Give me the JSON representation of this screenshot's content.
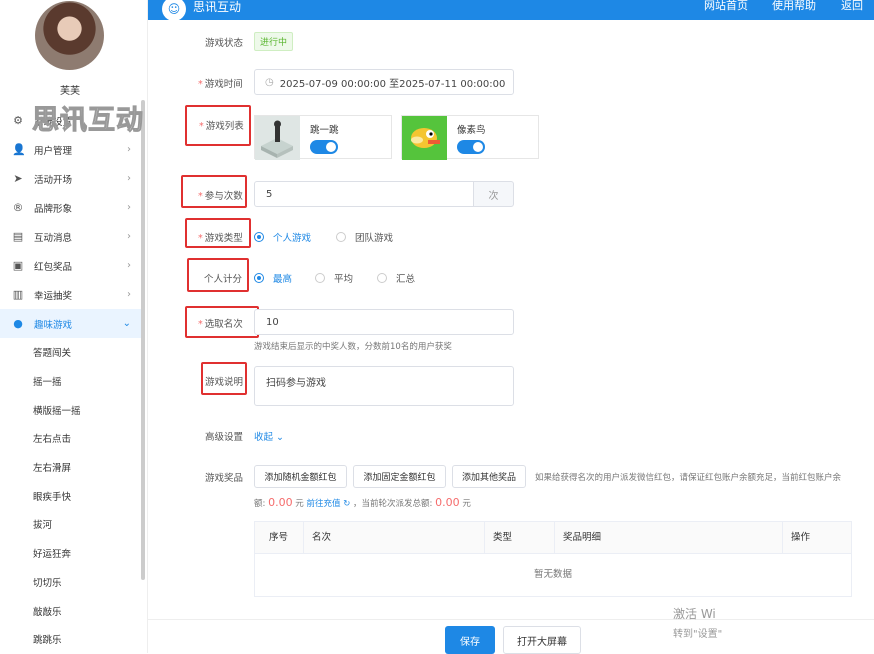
{
  "user": {
    "name": "芙芙"
  },
  "watermark": "思讯互动",
  "sidebar": {
    "items": [
      {
        "label": "系统设置",
        "icon": "gear-icon"
      },
      {
        "label": "用户管理",
        "icon": "user-icon"
      },
      {
        "label": "活动开场",
        "icon": "send-icon"
      },
      {
        "label": "品牌形象",
        "icon": "registered-icon"
      },
      {
        "label": "互动消息",
        "icon": "message-icon"
      },
      {
        "label": "红包奖品",
        "icon": "gift-icon"
      },
      {
        "label": "幸运抽奖",
        "icon": "lottery-icon"
      },
      {
        "label": "趣味游戏",
        "icon": "game-icon"
      }
    ],
    "subitems": [
      "答题闯关",
      "摇一摇",
      "横版摇一摇",
      "左右点击",
      "左右滑屏",
      "眼疾手快",
      "拔河",
      "好运狂奔",
      "切切乐",
      "敲敲乐",
      "跳跳乐"
    ]
  },
  "topbar": {
    "brand": "思讯互动",
    "links": [
      "网站首页",
      "使用帮助",
      "返回"
    ]
  },
  "form": {
    "status_label": "游戏状态",
    "status_value": "进行中",
    "time_label": "游戏时间",
    "time_value": "2025-07-09 00:00:00  至2025-07-11 00:00:00",
    "list_label": "游戏列表",
    "games": [
      {
        "name": "跳一跳",
        "icon": "jump-game-icon"
      },
      {
        "name": "像素鸟",
        "icon": "flappy-bird-icon"
      }
    ],
    "times_label": "参与次数",
    "times_value": "5",
    "times_unit": "次",
    "type_label": "游戏类型",
    "type_options": [
      "个人游戏",
      "团队游戏"
    ],
    "score_label": "个人计分",
    "score_options": [
      "最高",
      "平均",
      "汇总"
    ],
    "rank_label": "选取名次",
    "rank_value": "10",
    "rank_hint": "游戏结束后显示的中奖人数，分数前10名的用户获奖",
    "desc_label": "游戏说明",
    "desc_value": "扫码参与游戏",
    "advanced_label": "高级设置",
    "advanced_toggle": "收起",
    "prize_label": "游戏奖品",
    "prize_buttons": [
      "添加随机金额红包",
      "添加固定金额红包",
      "添加其他奖品"
    ],
    "prize_hint_1": "如果给获得名次的用户派发微信红包，请保证红包账户余额充足，当前红包账户余",
    "prize_hint_prefix": "额:",
    "balance": "0.00",
    "unit": "元",
    "recharge": "前往充值",
    "prize_hint_mid": "，当前轮次派发总额:",
    "total": "0.00",
    "unit2": "元"
  },
  "table": {
    "columns": [
      "序号",
      "名次",
      "类型",
      "奖品明细",
      "操作"
    ],
    "empty": "暂无数据"
  },
  "footer": {
    "save": "保存",
    "screen": "打开大屏幕"
  },
  "activate": {
    "line1": "激活 Wi",
    "line2": "转到\"设置\""
  }
}
